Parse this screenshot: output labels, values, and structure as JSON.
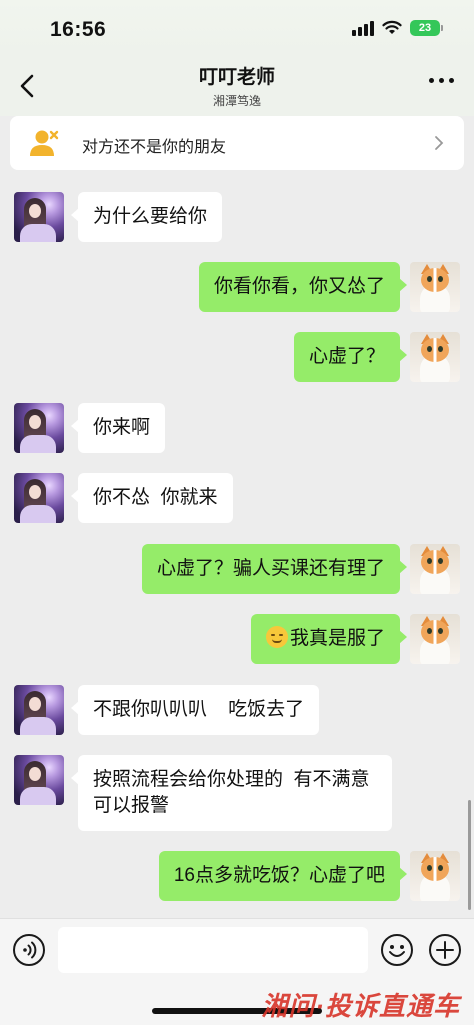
{
  "status": {
    "time": "16:56",
    "battery": "23"
  },
  "header": {
    "title": "叮叮老师",
    "subtitle": "湘潭笃逸"
  },
  "notice": {
    "text": "对方还不是你的朋友"
  },
  "messages": [
    {
      "side": "left",
      "text": "为什么要给你"
    },
    {
      "side": "right",
      "text": "你看你看，你又怂了"
    },
    {
      "side": "right",
      "text": "心虚了？"
    },
    {
      "side": "left",
      "text": "你来啊"
    },
    {
      "side": "left",
      "text": "你不怂  你就来"
    },
    {
      "side": "right",
      "text": "心虚了？骗人买课还有理了"
    },
    {
      "side": "right",
      "text": "我真是服了",
      "emoji": "smile-emoji"
    },
    {
      "side": "left",
      "text": "不跟你叭叭叭    吃饭去了"
    },
    {
      "side": "left",
      "text": "按照流程会给你处理的  有不满意  可以报警"
    },
    {
      "side": "right",
      "text": "16点多就吃饭？心虚了吧"
    }
  ],
  "input": {
    "placeholder": ""
  },
  "watermark": "湘问·投诉直通车"
}
